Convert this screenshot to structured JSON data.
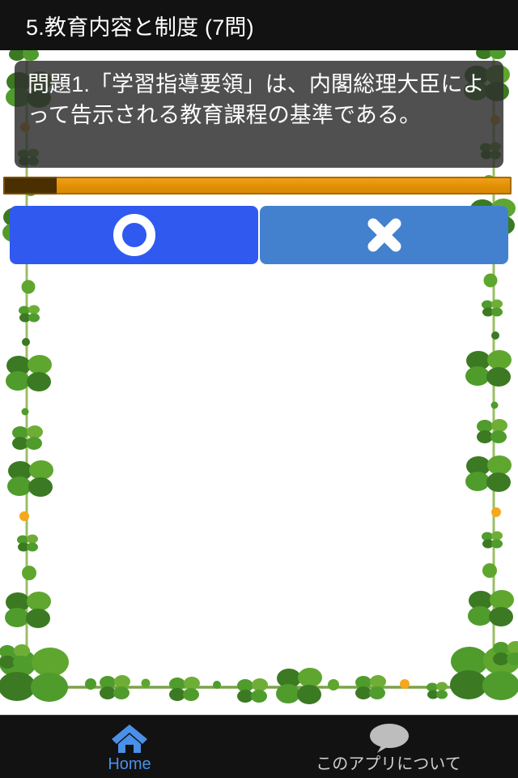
{
  "header": {
    "title": "5.教育内容と制度 (7問)"
  },
  "question": {
    "text": "問題1.「学習指導要領」は、内閣総理大臣によって告示される教育課程の基準である。",
    "number": 1,
    "total": 7
  },
  "progress": {
    "completed_percent": 10.5,
    "remaining_percent": 89.5,
    "done_color": "#4a3000",
    "remaining_color": "#e18f06"
  },
  "answers": [
    {
      "id": "maru",
      "icon": "circle-icon",
      "label": "○",
      "color": "#3059f0"
    },
    {
      "id": "batsu",
      "icon": "cross-icon",
      "label": "✖",
      "color": "#4381ce"
    }
  ],
  "tabbar": {
    "items": [
      {
        "id": "home",
        "icon": "home-icon",
        "label": "Home",
        "color": "#4a90e8",
        "active": true
      },
      {
        "id": "about",
        "icon": "speech-bubble-icon",
        "label": "このアプリについて",
        "color": "#cfcfcf",
        "active": false
      }
    ]
  },
  "decoration": {
    "theme": "clover-vine-border",
    "leaf_color": "#4f9c2d",
    "leaf_color_dark": "#3b7a22",
    "leaf_color_light": "#6fae36",
    "stem_color": "#9cbe66",
    "accent_dot_color": "#f5a81c"
  }
}
